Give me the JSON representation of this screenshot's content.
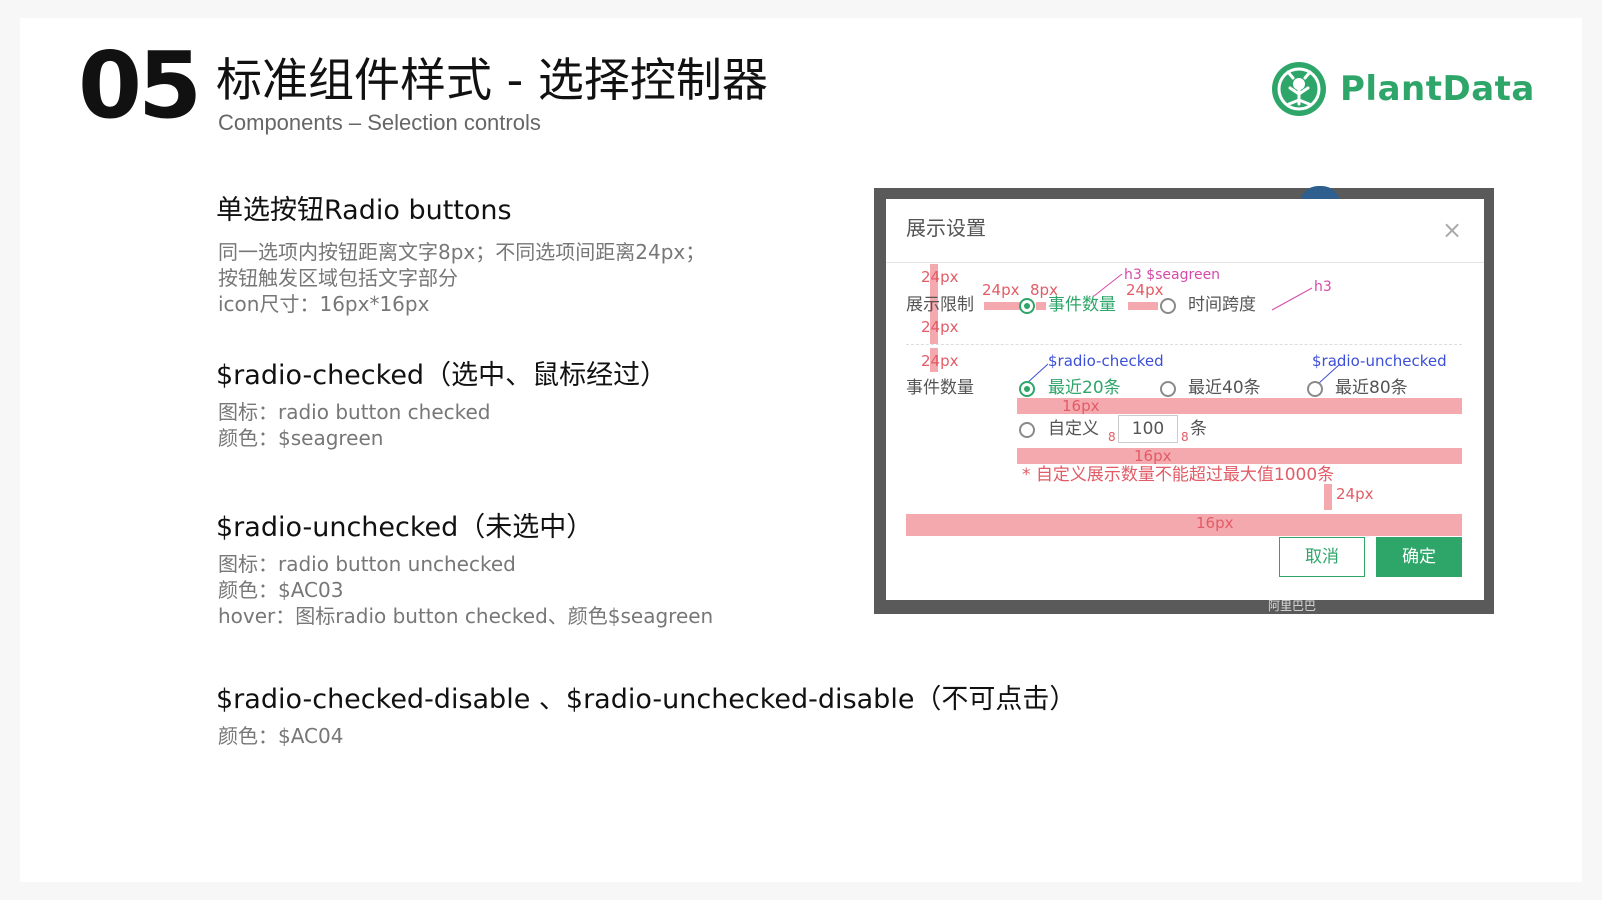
{
  "header": {
    "number": "05",
    "title_cn": "标准组件样式 - 选择控制器",
    "subtitle": "Components – Selection controls",
    "brand": "PlantData"
  },
  "sections": [
    {
      "title": "单选按钮Radio buttons",
      "lines": [
        "同一选项内按钮距离文字8px；不同选项间距离24px；",
        "按钮触发区域包括文字部分",
        "icon尺寸：16px*16px"
      ]
    },
    {
      "title": "$radio-checked（选中、鼠标经过）",
      "lines": [
        "图标：radio button checked",
        "颜色：$seagreen"
      ]
    },
    {
      "title": "$radio-unchecked（未选中）",
      "lines": [
        "图标：radio button unchecked",
        "颜色：$AC03",
        "hover：图标radio button checked、颜色$seagreen"
      ]
    },
    {
      "title": "$radio-checked-disable 、$radio-unchecked-disable（不可点击）",
      "lines": [
        "颜色：$AC04"
      ]
    }
  ],
  "dialog": {
    "title": "展示设置",
    "close": "×",
    "row1_label": "展示限制",
    "row1_options": [
      "事件数量",
      "时间跨度"
    ],
    "row2_label": "事件数量",
    "row2_options": [
      "最近20条",
      "最近40条",
      "最近80条"
    ],
    "custom_label": "自定义",
    "custom_value": "100",
    "custom_unit": "条",
    "hint": "* 自定义展示数量不能超过最大值1000条",
    "cancel": "取消",
    "ok": "确定",
    "map_text": "阿里巴巴"
  },
  "annotations": {
    "px24": "24px",
    "px8": "8px",
    "px16": "16px",
    "num8": "8",
    "h3_seagreen": "h3 $seagreen",
    "h3": "h3",
    "radio_checked": "$radio-checked",
    "radio_unchecked": "$radio-unchecked"
  },
  "colors": {
    "seagreen": "#2ea66a",
    "annotation_red": "#e25b66",
    "annotation_blue": "#3b4fd8",
    "annotation_bar": "#f4a9ae"
  }
}
